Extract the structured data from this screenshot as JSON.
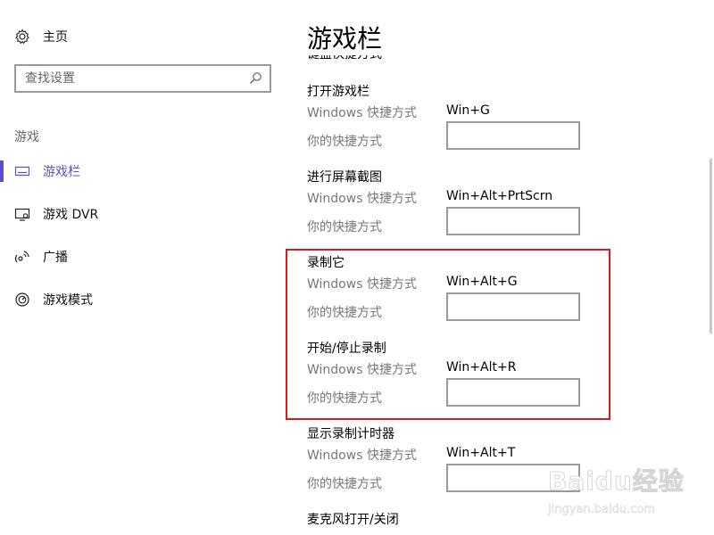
{
  "sidebar": {
    "home_label": "主页",
    "search_placeholder": "查找设置",
    "section_label": "游戏",
    "items": [
      {
        "label": "游戏栏",
        "icon": "game-bar-icon",
        "active": true
      },
      {
        "label": "游戏 DVR",
        "icon": "game-dvr-icon",
        "active": false
      },
      {
        "label": "广播",
        "icon": "broadcast-icon",
        "active": false
      },
      {
        "label": "游戏模式",
        "icon": "game-mode-icon",
        "active": false
      }
    ]
  },
  "main": {
    "title": "游戏栏",
    "clipped_heading": "键盘快捷方式",
    "windows_shortcut_label": "Windows 快捷方式",
    "your_shortcut_label": "你的快捷方式",
    "groups": [
      {
        "title": "打开游戏栏",
        "windows_shortcut": "Win+G",
        "your_shortcut": ""
      },
      {
        "title": "进行屏幕截图",
        "windows_shortcut": "Win+Alt+PrtScrn",
        "your_shortcut": ""
      },
      {
        "title": "录制它",
        "windows_shortcut": "Win+Alt+G",
        "your_shortcut": ""
      },
      {
        "title": "开始/停止录制",
        "windows_shortcut": "Win+Alt+R",
        "your_shortcut": ""
      },
      {
        "title": "显示录制计时器",
        "windows_shortcut": "Win+Alt+T",
        "your_shortcut": ""
      },
      {
        "title": "麦克风打开/关闭",
        "windows_shortcut": "",
        "your_shortcut": ""
      }
    ]
  },
  "colors": {
    "accent": "#5a4fcf",
    "highlight_border": "#d9191c",
    "secondary_text": "#777777"
  },
  "watermark": {
    "logo": "Baidu经验",
    "url": "jingyan.baidu.com"
  }
}
